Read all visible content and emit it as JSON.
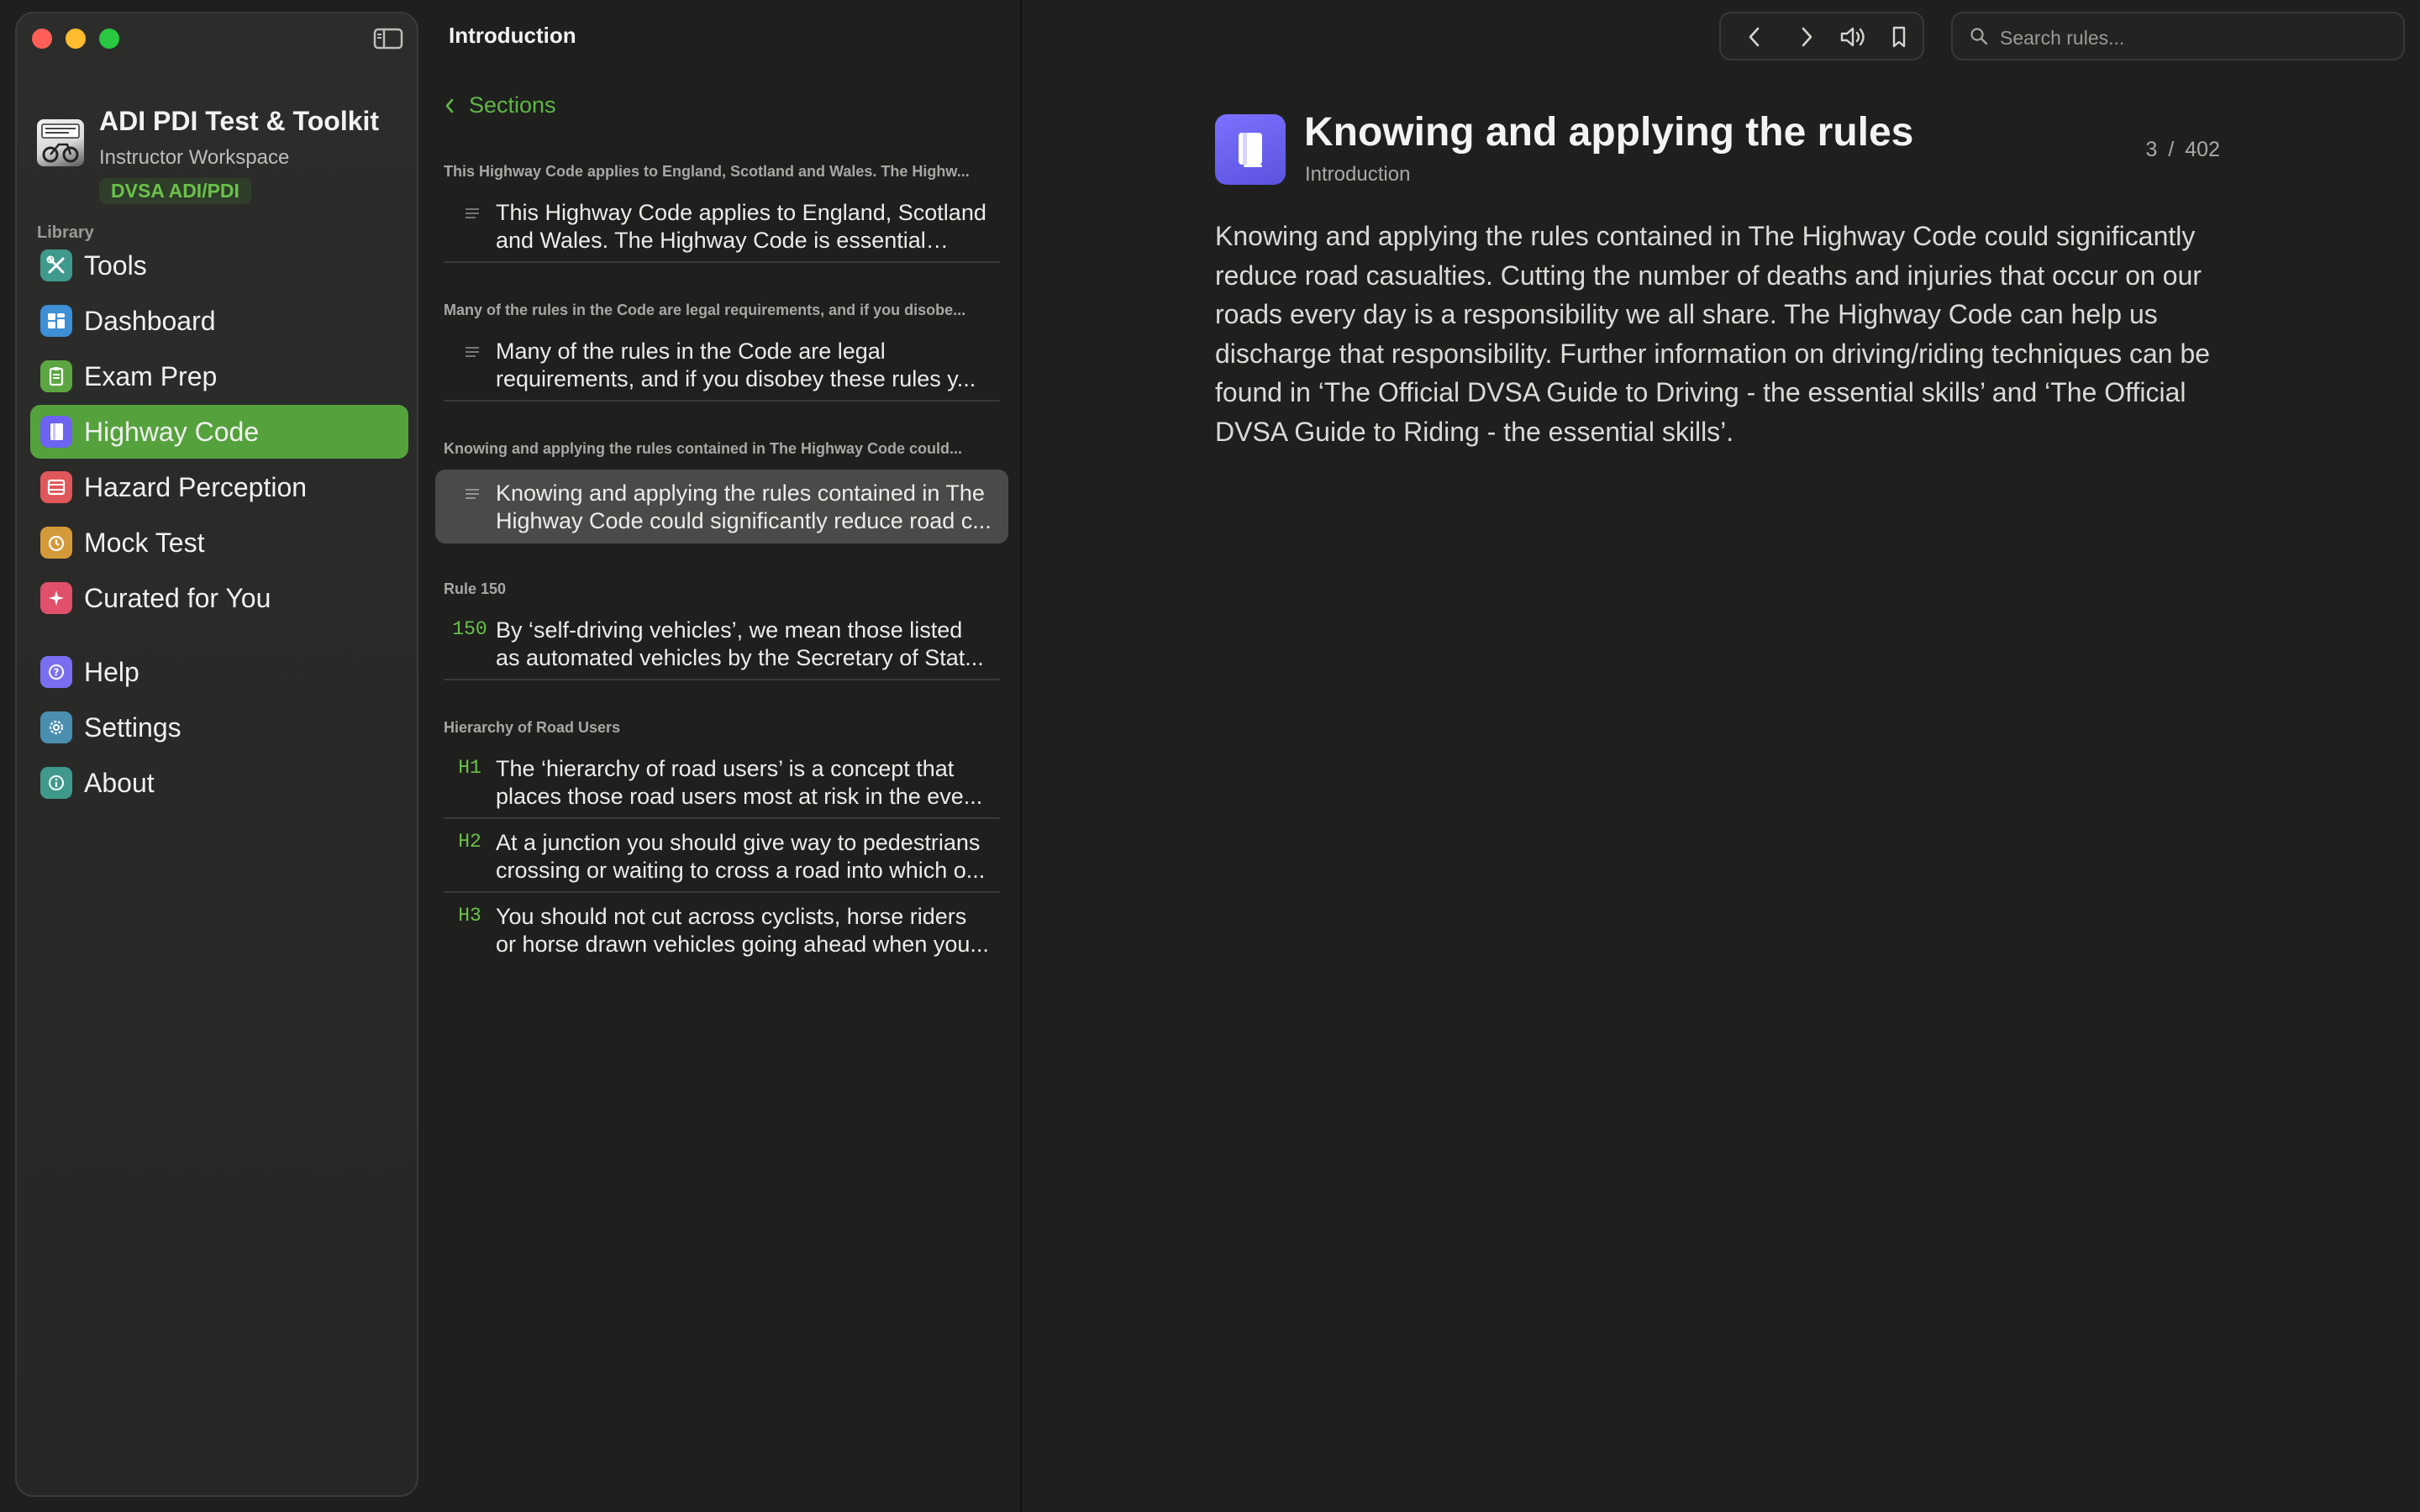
{
  "app": {
    "title": "ADI PDI Test & Toolkit",
    "subtitle": "Instructor Workspace",
    "badge": "DVSA ADI/PDI"
  },
  "sidebar": {
    "heading": "Library",
    "items": [
      {
        "label": "Tools",
        "icon": "tools-icon",
        "color": "#3f9a8c"
      },
      {
        "label": "Dashboard",
        "icon": "dashboard-icon",
        "color": "#3d8fd6"
      },
      {
        "label": "Exam Prep",
        "icon": "clipboard-icon",
        "color": "#5ba642"
      },
      {
        "label": "Highway Code",
        "icon": "book-icon",
        "color": "#6c63f0",
        "active": true
      },
      {
        "label": "Hazard Perception",
        "icon": "film-icon",
        "color": "#e0575b"
      },
      {
        "label": "Mock Test",
        "icon": "timer-icon",
        "color": "#d49a3a"
      },
      {
        "label": "Curated for You",
        "icon": "sparkles-icon",
        "color": "#e0506a"
      },
      {
        "label": "Help",
        "icon": "help-icon",
        "color": "#7a6ef0"
      },
      {
        "label": "Settings",
        "icon": "gear-icon",
        "color": "#4a8fb0"
      },
      {
        "label": "About",
        "icon": "info-icon",
        "color": "#3f9a8c"
      }
    ]
  },
  "list": {
    "title": "Introduction",
    "back_label": "Sections",
    "groups": [
      {
        "heading": "This Highway Code applies to England, Scotland and Wales. The Highw...",
        "rows": [
          {
            "num": "",
            "text": "This Highway Code applies to England, Scotland and Wales. The Highway Code is essential read..."
          }
        ]
      },
      {
        "heading": "Many of the rules in the Code are legal requirements, and if you disobe...",
        "rows": [
          {
            "num": "",
            "text": "Many of the rules in the Code are legal requirements, and if you disobey these rules y..."
          }
        ]
      },
      {
        "heading": "Knowing and applying the rules contained in The Highway Code could...",
        "rows": [
          {
            "num": "",
            "text": "Knowing and applying the rules contained in The Highway Code could significantly reduce road c...",
            "selected": true
          }
        ]
      },
      {
        "heading": "Rule 150",
        "rows": [
          {
            "num": "150",
            "text": "By ‘self-driving vehicles’, we mean those listed as automated vehicles by the Secretary of Stat..."
          }
        ]
      },
      {
        "heading": "Hierarchy of Road Users",
        "rows": [
          {
            "num": "H1",
            "text": "The ‘hierarchy of road users’ is a concept that places those road users most at risk in the eve..."
          },
          {
            "num": "H2",
            "text": "At a junction you should give way to pedestrians crossing or waiting to cross a road into which o..."
          },
          {
            "num": "H3",
            "text": "You should not cut across cyclists, horse riders or horse drawn vehicles going ahead when you..."
          }
        ]
      }
    ]
  },
  "toolbar": {
    "search_placeholder": "Search rules..."
  },
  "detail": {
    "title": "Knowing and applying the rules",
    "section": "Introduction",
    "position": "3",
    "separator": "/",
    "total": "402",
    "body": "Knowing and applying the rules contained in The Highway Code could significantly reduce road casualties. Cutting the number of deaths and injuries that occur on our roads every day is a responsibility we all share. The Highway Code can help us discharge that responsibility. Further information on driving/riding techniques can be found in ‘The Official DVSA Guide to Driving - the essential skills’ and ‘The Official DVSA Guide to Riding - the essential skills’."
  },
  "colors": {
    "accent": "#55a23d",
    "accent_text": "#6bc24a",
    "background": "#1f201e"
  }
}
